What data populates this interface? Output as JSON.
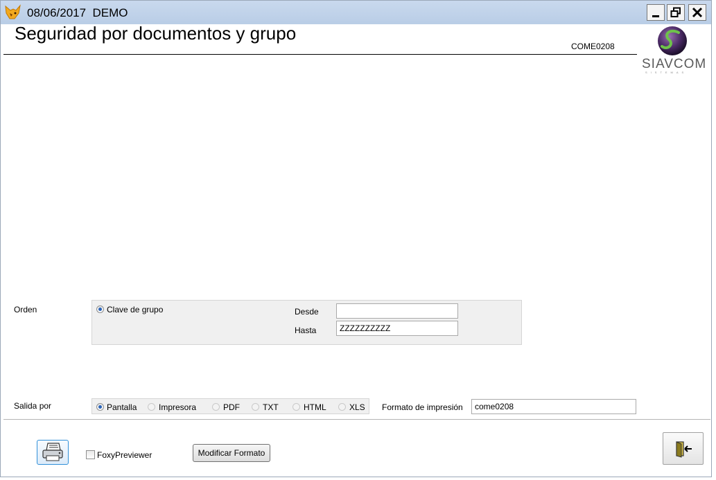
{
  "window": {
    "title": "08/06/2017  DEMO",
    "controls": {
      "minimize_icon": "minimize-icon",
      "restore_icon": "restore-icon",
      "close_icon": "close-icon"
    }
  },
  "header": {
    "title": "Seguridad por documentos y grupo",
    "code": "COME0208",
    "logo_text": "SIAVCOM",
    "logo_subtext": "SISTEMAS"
  },
  "orden": {
    "label": "Orden",
    "option_label": "Clave de grupo",
    "selected": true,
    "desde_label": "Desde",
    "desde_value": "",
    "hasta_label": "Hasta",
    "hasta_value": "ZZZZZZZZZZ"
  },
  "salida": {
    "label": "Salida por",
    "options": [
      {
        "label": "Pantalla",
        "selected": true
      },
      {
        "label": "Impresora",
        "selected": false
      },
      {
        "label": "PDF",
        "selected": false
      },
      {
        "label": "TXT",
        "selected": false
      },
      {
        "label": "HTML",
        "selected": false
      },
      {
        "label": "XLS",
        "selected": false
      }
    ],
    "formato_label": "Formato de impresión",
    "formato_value": "come0208"
  },
  "footer": {
    "foxy_label": "FoxyPreviewer",
    "foxy_checked": false,
    "modificar_label": "Modificar Formato",
    "print_icon": "printer-icon",
    "exit_icon": "exit-door-icon"
  },
  "colors": {
    "titlebar": "#c9d9ee",
    "radio_selected": "#2a63b8",
    "print_border": "#2f8fd8"
  }
}
